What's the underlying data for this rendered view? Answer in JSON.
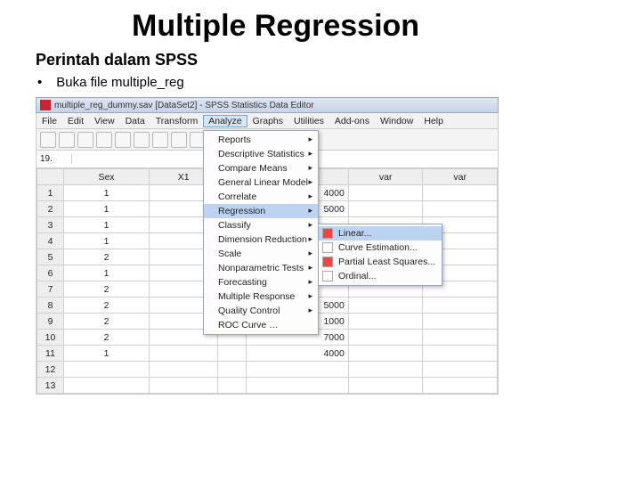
{
  "slide": {
    "title": "Multiple Regression",
    "subtitle": "Perintah dalam SPSS",
    "bullet": "Buka file multiple_reg"
  },
  "window": {
    "title": "multiple_reg_dummy.sav [DataSet2] - SPSS Statistics Data Editor",
    "cell_addr": "19."
  },
  "menubar": {
    "items": [
      "File",
      "Edit",
      "View",
      "Data",
      "Transform",
      "Analyze",
      "Graphs",
      "Utilities",
      "Add-ons",
      "Window",
      "Help"
    ],
    "active_index": 5
  },
  "analyze_menu": {
    "items": [
      {
        "label": "Reports",
        "sub": true
      },
      {
        "label": "Descriptive Statistics",
        "sub": true
      },
      {
        "label": "Compare Means",
        "sub": true
      },
      {
        "label": "General Linear Model",
        "sub": true
      },
      {
        "label": "Correlate",
        "sub": true
      },
      {
        "label": "Regression",
        "sub": true,
        "highlight": true
      },
      {
        "label": "Classify",
        "sub": true
      },
      {
        "label": "Dimension Reduction",
        "sub": true
      },
      {
        "label": "Scale",
        "sub": true
      },
      {
        "label": "Nonparametric Tests",
        "sub": true
      },
      {
        "label": "Forecasting",
        "sub": true
      },
      {
        "label": "Multiple Response",
        "sub": true
      },
      {
        "label": "Quality Control",
        "sub": true
      },
      {
        "label": "ROC Curve …",
        "sub": false
      }
    ]
  },
  "regression_submenu": {
    "items": [
      {
        "label": "Linear...",
        "highlight": true,
        "icon": "red"
      },
      {
        "label": "Curve Estimation...",
        "icon": "chk"
      },
      {
        "label": "Partial Least Squares...",
        "icon": "red"
      },
      {
        "label": "Ordinal...",
        "icon": "r"
      }
    ]
  },
  "grid": {
    "headers": [
      "",
      "Sex",
      "X1",
      "",
      "",
      "var",
      "var"
    ],
    "rows": [
      {
        "n": "1",
        "sex": "1",
        "x1": "",
        "tail": "4000"
      },
      {
        "n": "2",
        "sex": "1",
        "x1": "",
        "tail": "5000"
      },
      {
        "n": "3",
        "sex": "1",
        "x1": "",
        "tail": ""
      },
      {
        "n": "4",
        "sex": "1",
        "x1": "",
        "tail": ""
      },
      {
        "n": "5",
        "sex": "2",
        "x1": "",
        "tail": ""
      },
      {
        "n": "6",
        "sex": "1",
        "x1": "",
        "tail": ""
      },
      {
        "n": "7",
        "sex": "2",
        "x1": "",
        "tail": ""
      },
      {
        "n": "8",
        "sex": "2",
        "x1": "",
        "tail": "5000"
      },
      {
        "n": "9",
        "sex": "2",
        "x1": "",
        "tail": "1000"
      },
      {
        "n": "10",
        "sex": "2",
        "x1": "",
        "tail": "7000"
      },
      {
        "n": "11",
        "sex": "1",
        "x1": "",
        "tail": "4000"
      },
      {
        "n": "12",
        "sex": "",
        "x1": "",
        "tail": ""
      },
      {
        "n": "13",
        "sex": "",
        "x1": "",
        "tail": ""
      }
    ]
  }
}
